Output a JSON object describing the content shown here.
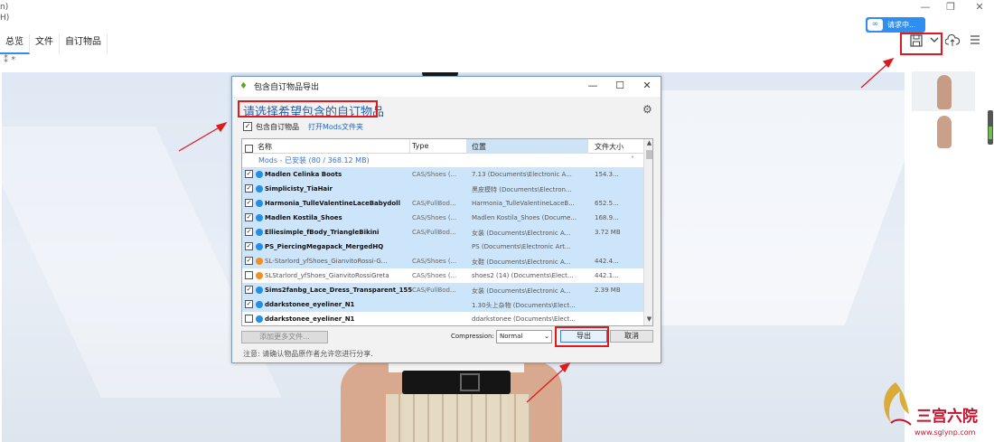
{
  "window": {
    "left_fragment_1": "n)",
    "left_fragment_2": "H)",
    "controls": [
      "—",
      "❐",
      "✕"
    ]
  },
  "status_badge": {
    "label": "请求中..."
  },
  "tabs": [
    {
      "label": "总览"
    },
    {
      "label": "文件"
    },
    {
      "label": "自订物品"
    }
  ],
  "subrow": {
    "label": "*"
  },
  "toolbar": {
    "save_icon": "save-icon",
    "dropdown_icon": "chevron-down-icon",
    "cloud_icon": "cloud-upload-icon",
    "menu_icon": "menu-icon"
  },
  "dialog": {
    "title": "包含自订物品导出",
    "controls": [
      "—",
      "☐",
      "✕"
    ],
    "heading": "请选择希望包含的自订物品",
    "include_checkbox_label": "包含自订物品",
    "open_mods_link": "打开Mods文件夹",
    "columns": {
      "name": "名称",
      "type": "Type",
      "location": "位置",
      "size": "文件大小"
    },
    "group_label": "Mods - 已安装 (80 / 368.12 MB)",
    "rows": [
      {
        "checked": true,
        "dot": "blue",
        "selected": true,
        "dim": false,
        "name": "Madlen Celinka Boots",
        "type": "CAS/Shoes (...",
        "location": "7.13 (Documents\\Electronic A...",
        "size": "154.3..."
      },
      {
        "checked": true,
        "dot": "blue",
        "selected": true,
        "dim": false,
        "name": "Simplicisty_TiaHair",
        "type": "",
        "location": "黑皮模特 (Documents\\Electron...",
        "size": ""
      },
      {
        "checked": true,
        "dot": "blue",
        "selected": true,
        "dim": false,
        "name": "Harmonia_TulleValentineLaceBabydoll",
        "type": "CAS/FullBod...",
        "location": "Harmonia_TulleValentineLaceB...",
        "size": "652.5..."
      },
      {
        "checked": true,
        "dot": "blue",
        "selected": true,
        "dim": false,
        "name": "Madlen Kostila_Shoes",
        "type": "CAS/Shoes (...",
        "location": "Madlen Kostila_Shoes (Docume...",
        "size": "168.9..."
      },
      {
        "checked": true,
        "dot": "blue",
        "selected": true,
        "dim": false,
        "name": "Elliesimple_fBody_TriangleBikini",
        "type": "CAS/FullBod...",
        "location": "女装 (Documents\\Electronic A...",
        "size": "3.72 MB"
      },
      {
        "checked": true,
        "dot": "blue",
        "selected": true,
        "dim": false,
        "name": "PS_PiercingMegapack_MergedHQ",
        "type": "",
        "location": "PS (Documents\\Electronic Art...",
        "size": ""
      },
      {
        "checked": true,
        "dot": "orange",
        "selected": true,
        "dim": true,
        "name": "SL-Starlord_yfShoes_GianvitoRossi-G...",
        "type": "CAS/Shoes (...",
        "location": "女鞋 (Documents\\Electronic A...",
        "size": "442.4..."
      },
      {
        "checked": false,
        "dot": "orange",
        "selected": false,
        "dim": true,
        "name": "SLStarlord_yfShoes_GianvitoRossiGreta",
        "type": "CAS/Shoes (...",
        "location": "shoes2 (14) (Documents\\Elect...",
        "size": "442.1..."
      },
      {
        "checked": true,
        "dot": "blue",
        "selected": true,
        "dim": false,
        "name": "Sims2fanbg_Lace_Dress_Transparent_155",
        "type": "CAS/FullBod...",
        "location": "女装 (Documents\\Electronic A...",
        "size": "2.39 MB"
      },
      {
        "checked": true,
        "dot": "blue",
        "selected": true,
        "dim": false,
        "name": "ddarkstonee_eyeliner_N1",
        "type": "",
        "location": "1.30头上杂物 (Documents\\Elect...",
        "size": ""
      },
      {
        "checked": false,
        "dot": "blue",
        "selected": false,
        "dim": false,
        "name": "ddarkstonee_eyeliner_N1",
        "type": "",
        "location": "ddarkstonee (Documents\\Elect...",
        "size": ""
      }
    ],
    "add_more_button": "添加更多文件...",
    "compression_label": "Compression:",
    "compression_value": "Normal",
    "export_button": "导出",
    "cancel_button": "取消",
    "note": "注意: 请确认物品原作者允许您进行分享."
  },
  "watermark": {
    "text": "三宫六院",
    "url": "www.sglynp.com"
  },
  "colors": {
    "accent": "#2e8ff0",
    "highlight_red": "#e0191e",
    "selected_row": "#cde5fb"
  }
}
